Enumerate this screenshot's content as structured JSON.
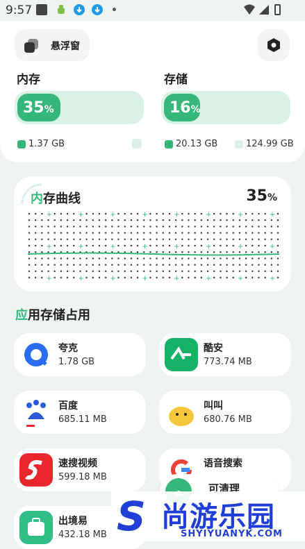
{
  "status_bar": {
    "time": "9:57"
  },
  "header": {
    "float_window_label": "悬浮窗"
  },
  "memory": {
    "title": "内存",
    "percent": 35,
    "percent_value": "35",
    "percent_unit": "%",
    "used_label": "1.37 GB",
    "free_label": ""
  },
  "storage": {
    "title": "存储",
    "percent": 16,
    "percent_value": "16",
    "percent_unit": "%",
    "used_label": "20.13 GB",
    "total_label": "124.99 GB"
  },
  "memory_curve": {
    "title_highlight": "内",
    "title_rest": "存曲线",
    "percent_value": "35",
    "percent_unit": "%"
  },
  "apps_section": {
    "title_highlight": "应",
    "title_rest": "用存储占用",
    "apps": [
      {
        "name": "夸克",
        "size": "1.78 GB",
        "icon": "quark-icon",
        "color": "#ffffff"
      },
      {
        "name": "酷安",
        "size": "773.74 MB",
        "icon": "coolapk-icon",
        "color": "#14b267"
      },
      {
        "name": "百度",
        "size": "685.11 MB",
        "icon": "baidu-icon",
        "color": "#ffffff"
      },
      {
        "name": "叫叫",
        "size": "680.76 MB",
        "icon": "jiaojiao-icon",
        "color": "#ffffff"
      },
      {
        "name": "速搜视频",
        "size": "599.18 MB",
        "icon": "susou-icon",
        "color": "#e8262c"
      },
      {
        "name": "语音搜索",
        "size": "",
        "icon": "google-icon",
        "color": "#ffffff"
      },
      {
        "name": "出境易",
        "size": "432.18 MB",
        "icon": "chujingyi-icon",
        "color": "#2fbf86"
      }
    ]
  },
  "clean_button": {
    "label": "可清理"
  },
  "watermark": {
    "logo": "S",
    "text": "尚游乐园",
    "url": "SHYIYUANYK.COM"
  }
}
